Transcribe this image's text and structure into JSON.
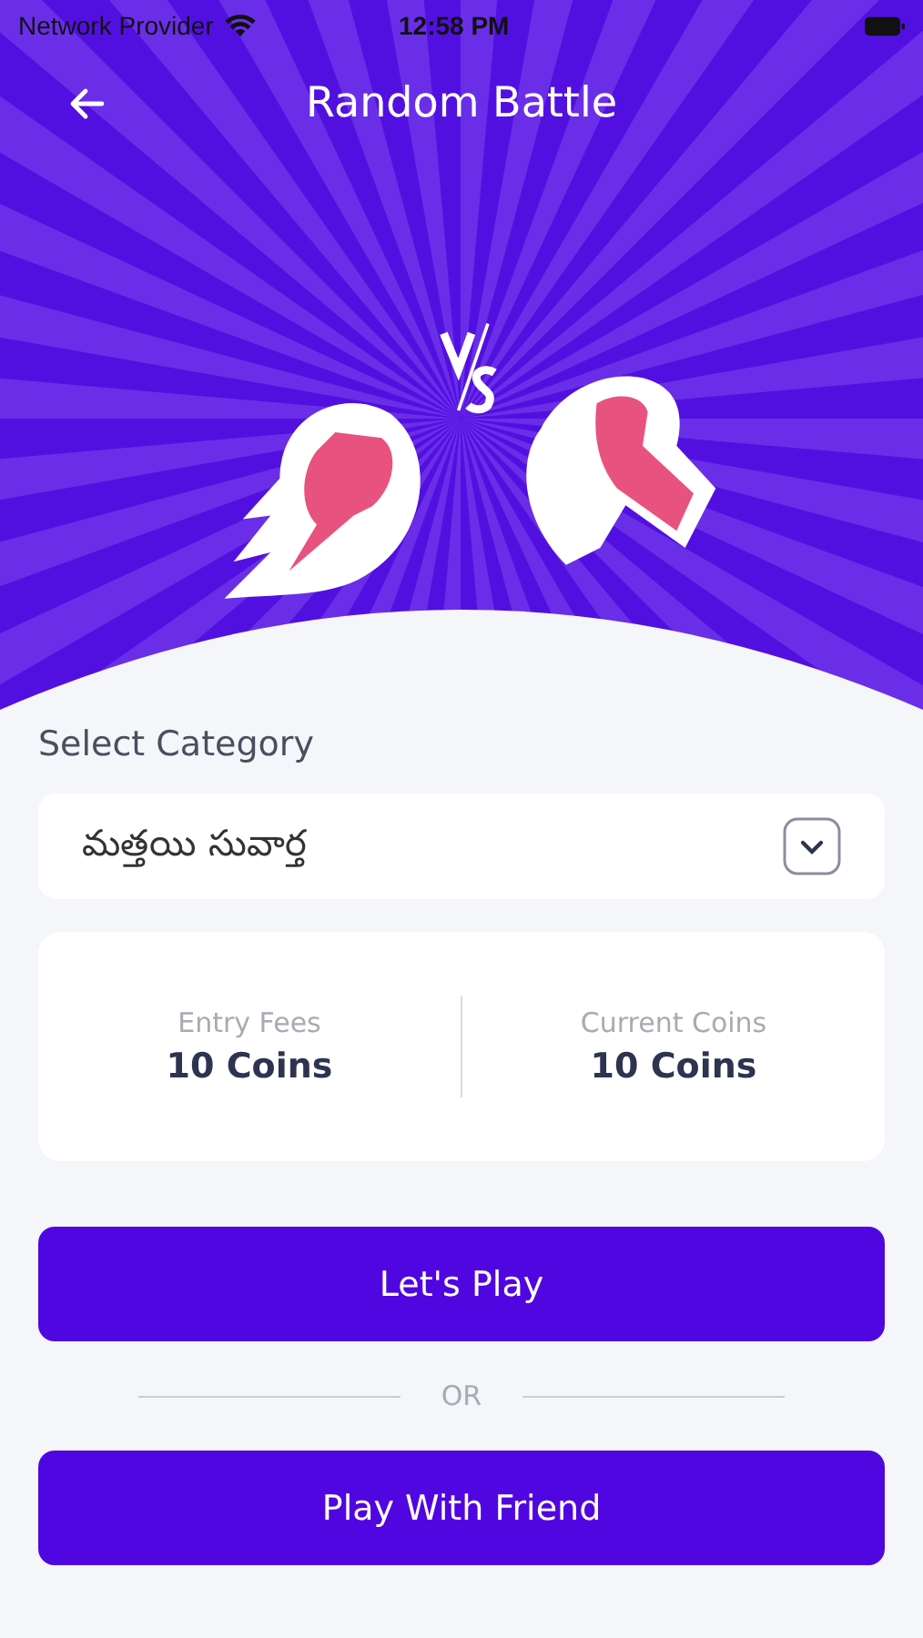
{
  "status_bar": {
    "carrier": "Network Provider",
    "time": "12:58 PM"
  },
  "header": {
    "title": "Random Battle"
  },
  "category": {
    "label": "Select Category",
    "value": "మత్తయి సువార్త"
  },
  "stats": [
    {
      "label": "Entry Fees",
      "value": "10 Coins"
    },
    {
      "label": "Current Coins",
      "value": "10 Coins"
    }
  ],
  "buttons": {
    "primary": "Let's Play",
    "divider": "OR",
    "secondary": "Play With Friend"
  }
}
